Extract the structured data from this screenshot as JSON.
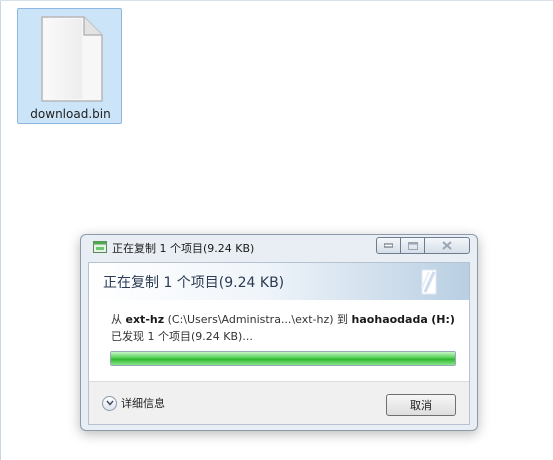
{
  "desktop": {
    "file": {
      "name": "download.bin",
      "icon": "blank-file-icon"
    }
  },
  "dialog": {
    "title": "正在复制 1 个项目(9.24 KB)",
    "heading": "正在复制 1 个项目(9.24 KB)",
    "from_prefix": "从",
    "source_name": "ext-hz",
    "source_path": "(C:\\Users\\Administra...\\ext-hz)",
    "to_word": "到",
    "dest_name": "haohaodada",
    "dest_drive": "(H:)",
    "status": "已发现 1 个项目(9.24 KB)...",
    "progress": 1.0,
    "details_label": "详细信息",
    "cancel_label": "取消",
    "colors": {
      "progress": "#3cc43c",
      "heading": "#2b3c54",
      "selection": "#cce4f7"
    }
  }
}
